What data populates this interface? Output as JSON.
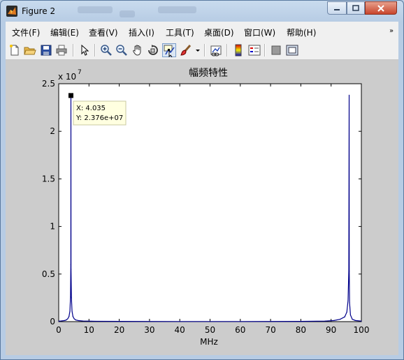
{
  "window": {
    "title": "Figure 2",
    "controls": [
      "minimize",
      "maximize",
      "close"
    ]
  },
  "menu": {
    "items": [
      "文件(F)",
      "编辑(E)",
      "查看(V)",
      "插入(I)",
      "工具(T)",
      "桌面(D)",
      "窗口(W)",
      "帮助(H)"
    ],
    "overflow_icon": "chevron-double-icon"
  },
  "toolbar": {
    "buttons": [
      "new-figure",
      "open-file",
      "save",
      "print",
      "edit-plot",
      "zoom-in",
      "zoom-out",
      "pan",
      "rotate-3d",
      "data-cursor",
      "brush",
      "brush-dropdown",
      "link-plot",
      "insert-colorbar",
      "insert-legend",
      "hide-plot-tools",
      "show-plot-tools"
    ],
    "active": "data-cursor"
  },
  "chart_data": {
    "type": "line",
    "title": "幅频特性",
    "xlabel": "MHz",
    "ylabel": "",
    "exponent_label": "x 10",
    "exponent_power": "7",
    "xlim": [
      0,
      100
    ],
    "ylim": [
      0,
      25000000
    ],
    "xticks": [
      0,
      10,
      20,
      30,
      40,
      50,
      60,
      70,
      80,
      90,
      100
    ],
    "yticks": [
      0,
      5000000,
      10000000,
      15000000,
      20000000,
      25000000
    ],
    "ytick_labels": [
      "0",
      "0.5",
      "1",
      "1.5",
      "2",
      "2.5"
    ],
    "series": [
      {
        "color": "#00008b",
        "x": [
          0,
          1,
          2,
          2.5,
          3,
          3.4,
          3.7,
          3.9,
          4.0,
          4.035,
          4.07,
          4.2,
          4.4,
          4.7,
          5.1,
          5.6,
          6.5,
          8,
          12,
          20,
          40,
          60,
          80,
          88,
          91,
          93,
          94.5,
          95.2,
          95.6,
          95.85,
          95.965,
          96.0,
          96.1,
          96.4,
          97,
          98,
          100
        ],
        "y": [
          50000,
          80000,
          120000,
          180000,
          300000,
          550000,
          1100000,
          2600000,
          6000000,
          23760000,
          5500000,
          2500000,
          1100000,
          550000,
          300000,
          180000,
          110000,
          70000,
          40000,
          25000,
          15000,
          15000,
          25000,
          60000,
          120000,
          250000,
          500000,
          1000000,
          2200000,
          5400000,
          23800000,
          5300000,
          2000000,
          700000,
          250000,
          120000,
          60000
        ]
      }
    ],
    "datatip": {
      "x_label": "X: 4.035",
      "y_label": "Y: 2.376e+07",
      "x": 4.035,
      "y": 23760000
    }
  }
}
